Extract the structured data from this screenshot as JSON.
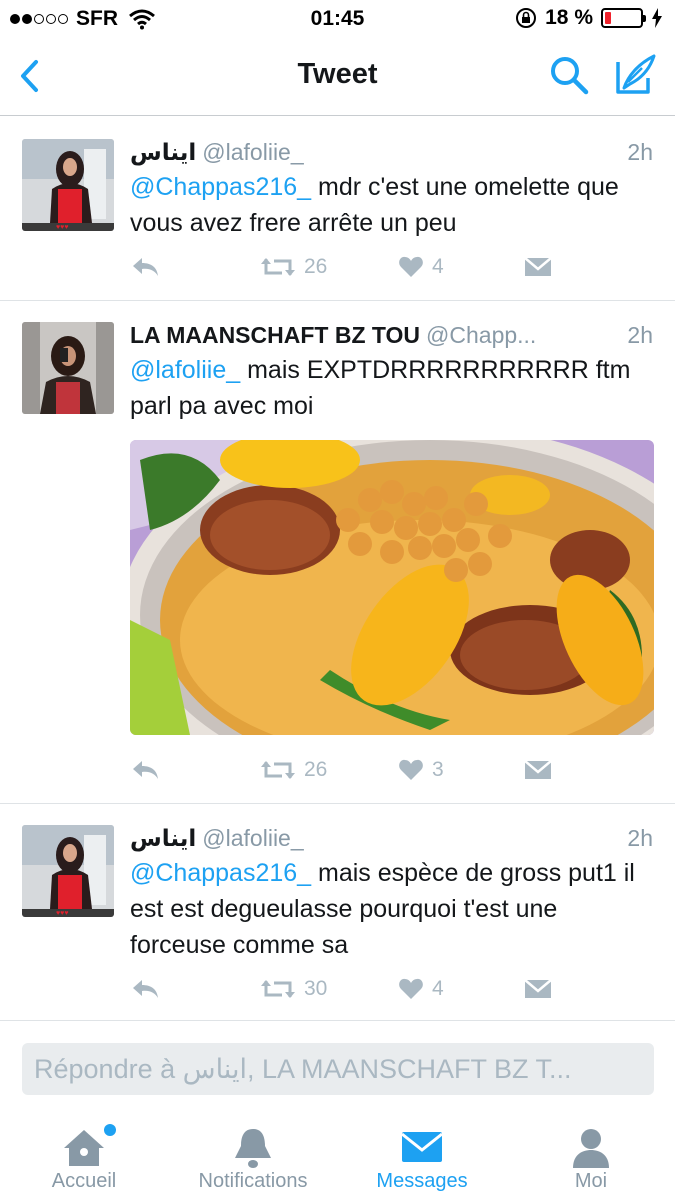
{
  "status_bar": {
    "carrier": "SFR",
    "time": "01:45",
    "battery": "18 %",
    "battery_level": 0.18,
    "battery_color": "#f0222c"
  },
  "nav": {
    "title": "Tweet"
  },
  "tweets": [
    {
      "name": "ايناس",
      "handle": "@lafoliie_",
      "time": "2h",
      "mention": "@Chappas216_",
      "text": " mdr c'est une omelette que vous avez frere arrête un peu",
      "retweets": "26",
      "likes": "4"
    },
    {
      "name": "LA MAANSCHAFT BZ TOU",
      "handle": "@Chapp...",
      "time": "2h",
      "mention": "@lafoliie_",
      "text": " mais EXPTDRRRRRRRRRRR ftm parl pa avec moi",
      "retweets": "26",
      "likes": "3",
      "has_media": true
    },
    {
      "name": "ايناس",
      "handle": "@lafoliie_",
      "time": "2h",
      "mention": "@Chappas216_",
      "text": " mais espèce de gross put1 il est est degueulasse pourquoi t'est une forceuse comme sa",
      "retweets": "30",
      "likes": "4"
    }
  ],
  "reply": {
    "placeholder": "Répondre à ايناس, LA MAANSCHAFT BZ T..."
  },
  "tabs": [
    {
      "label": "Accueil",
      "icon": "home-icon",
      "active": false,
      "badge": true
    },
    {
      "label": "Notifications",
      "icon": "bell-icon",
      "active": false
    },
    {
      "label": "Messages",
      "icon": "envelope-icon",
      "active": true
    },
    {
      "label": "Moi",
      "icon": "person-icon",
      "active": false
    }
  ],
  "colors": {
    "accent": "#1da1f2",
    "muted": "#8899a6",
    "action": "#aab8c2"
  }
}
